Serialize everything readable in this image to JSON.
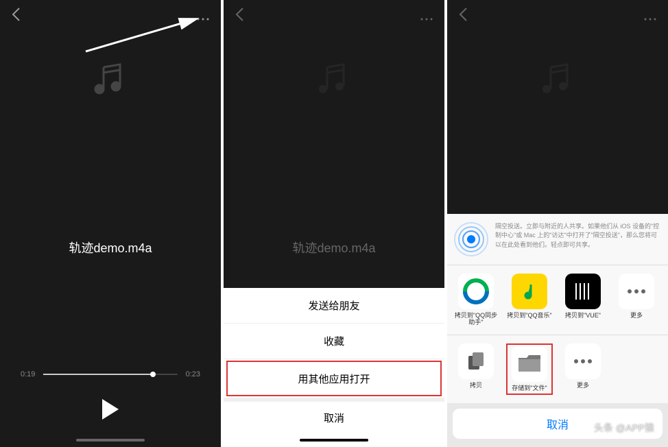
{
  "file": {
    "name": "轨迹demo.m4a"
  },
  "player": {
    "current_time": "0:19",
    "total_time": "0:23"
  },
  "action_sheet": {
    "send_to_friend": "发送给朋友",
    "favorite": "收藏",
    "open_with_other": "用其他应用打开",
    "cancel": "取消"
  },
  "share_sheet": {
    "airdrop_text": "隔空投送。立即与附近的人共享。如果他们从 iOS 设备的\"控制中心\"或 Mac 上的\"访达\"中打开了\"隔空投送\"，那么您将可以在此处看到他们。轻点即可共享。",
    "apps": {
      "qq_sync": "拷贝到\"QQ同步助手\"",
      "qq_music": "拷贝到\"QQ音乐\"",
      "vue": "拷贝到\"VUE\"",
      "more": "更多"
    },
    "actions": {
      "copy": "拷贝",
      "save_to_files": "存储到\"文件\"",
      "more": "更多"
    },
    "cancel": "取消"
  },
  "watermark": "头条 @APP猿"
}
